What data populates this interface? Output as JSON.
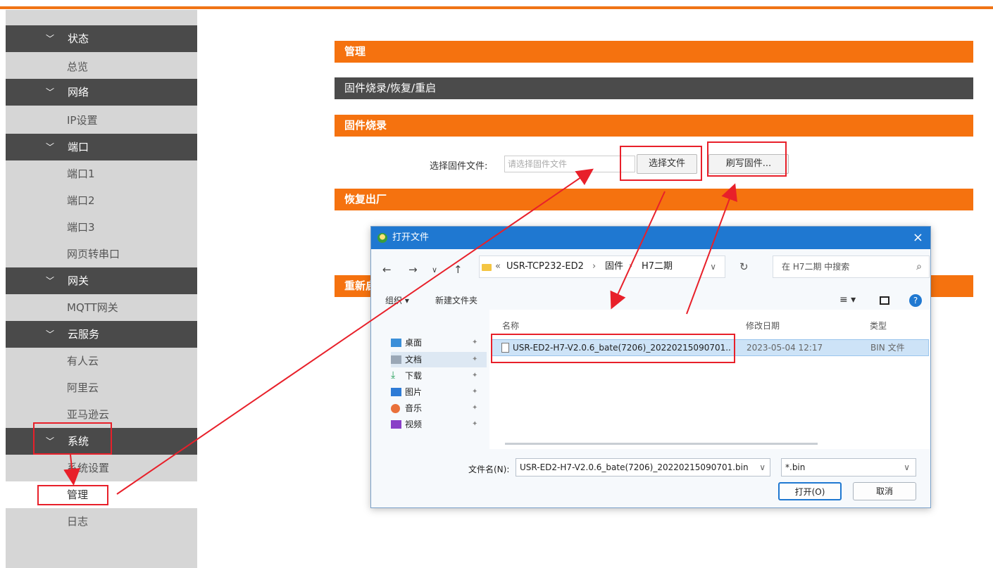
{
  "sidebar": {
    "sections": [
      {
        "label": "状态",
        "items": [
          "总览"
        ]
      },
      {
        "label": "网络",
        "items": [
          "IP设置"
        ]
      },
      {
        "label": "端口",
        "items": [
          "端口1",
          "端口2",
          "端口3",
          "网页转串口"
        ]
      },
      {
        "label": "网关",
        "items": [
          "MQTT网关"
        ]
      },
      {
        "label": "云服务",
        "items": [
          "有人云",
          "阿里云",
          "亚马逊云"
        ]
      },
      {
        "label": "系统",
        "items": [
          "系统设置",
          "管理",
          "日志"
        ]
      }
    ],
    "active_item": "管理"
  },
  "main": {
    "header_manage": "管理",
    "header_subtitle": "固件烧录/恢复/重启",
    "section_firmware": "固件烧录",
    "firmware_label": "选择固件文件:",
    "firmware_placeholder": "请选择固件文件",
    "choose_file_button": "选择文件",
    "flash_button": "刷写固件...",
    "section_restore": "恢复出厂",
    "section_reboot": "重新启"
  },
  "dialog": {
    "title": "打开文件",
    "close": "×",
    "path": [
      "«",
      "USR-TCP232-ED2",
      "›",
      "固件",
      "›",
      "H7二期"
    ],
    "search_placeholder": "在 H7二期 中搜索",
    "toolbar_organize": "组织 ▾",
    "toolbar_new_folder": "新建文件夹",
    "nav_items": [
      "桌面",
      "文档",
      "下载",
      "图片",
      "音乐",
      "视频"
    ],
    "columns": {
      "name": "名称",
      "date": "修改日期",
      "type": "类型"
    },
    "file": {
      "name": "USR-ED2-H7-V2.0.6_bate(7206)_20220215090701..",
      "date": "2023-05-04 12:17",
      "type": "BIN 文件"
    },
    "filename_label": "文件名(N):",
    "filename_value": "USR-ED2-H7-V2.0.6_bate(7206)_20220215090701.bin",
    "filetype_value": "*.bin",
    "open_button": "打开(O)",
    "cancel_button": "取消"
  },
  "colors": {
    "accent": "#f5720f",
    "dark_bar": "#4b4b4b",
    "dialog_title": "#1f78d1",
    "annotation": "#e8202a"
  }
}
